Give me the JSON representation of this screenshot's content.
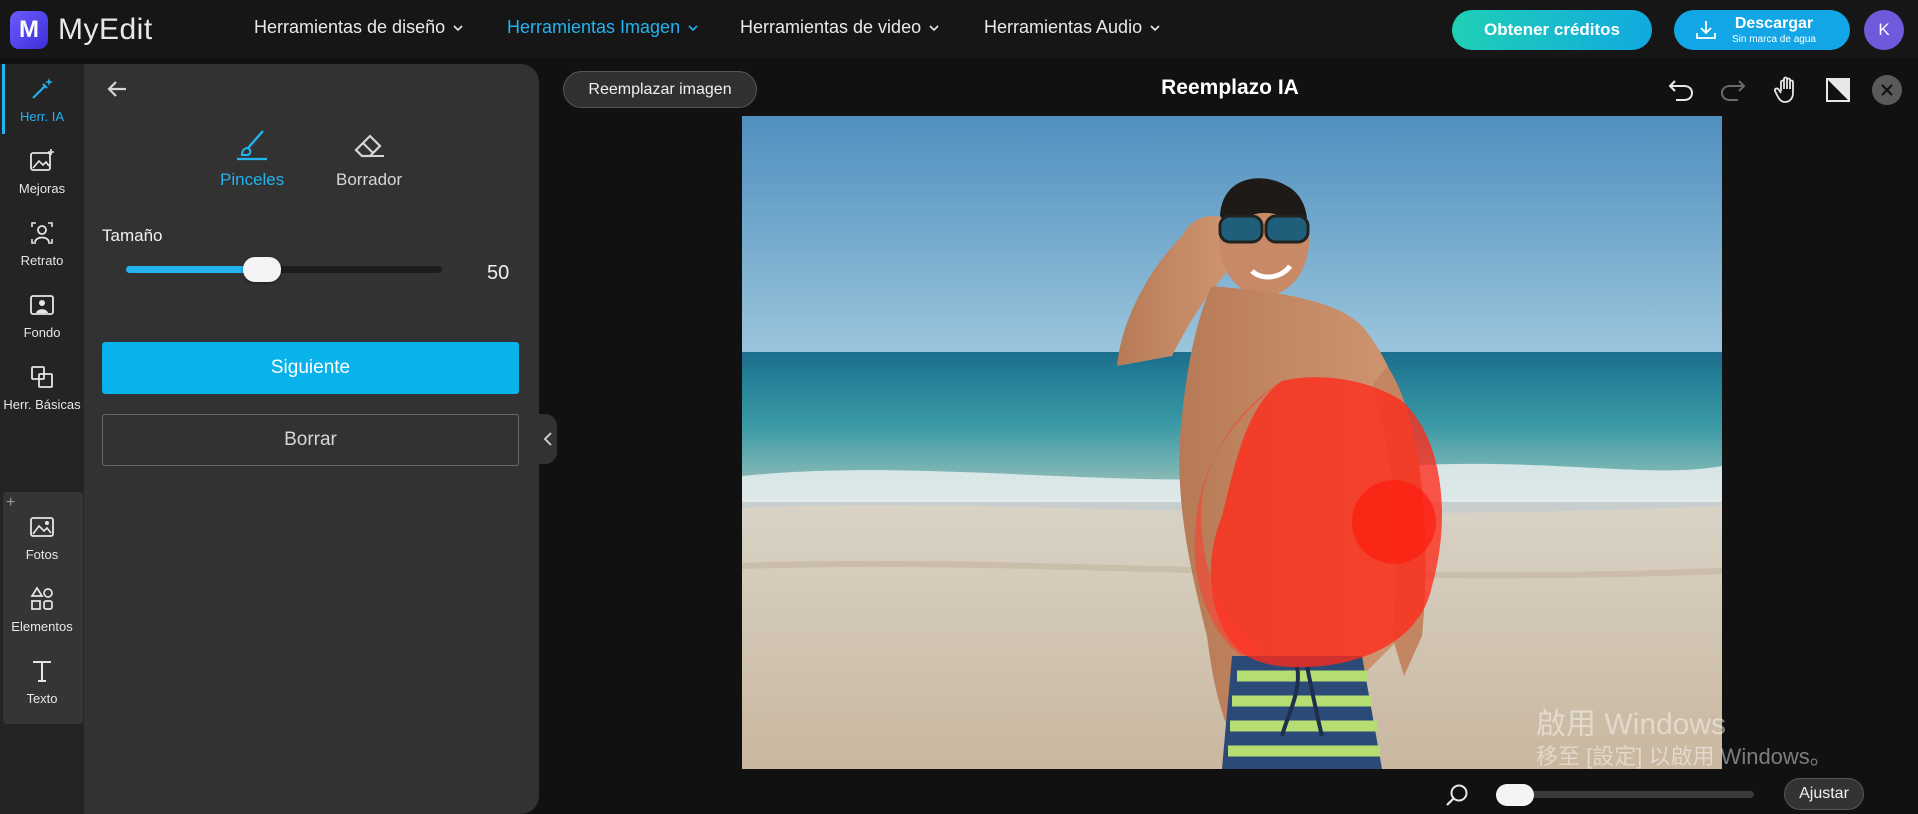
{
  "app": {
    "logo_letter": "M",
    "name": "MyEdit"
  },
  "nav": [
    {
      "label": "Herramientas de diseño",
      "active": false
    },
    {
      "label": "Herramientas Imagen",
      "active": true
    },
    {
      "label": "Herramientas de video",
      "active": false
    },
    {
      "label": "Herramientas Audio",
      "active": false
    }
  ],
  "header": {
    "credits_label": "Obtener créditos",
    "download_label": "Descargar",
    "download_sub": "Sin marca de agua",
    "avatar_letter": "K"
  },
  "rail": {
    "items": [
      {
        "label": "Herr. IA",
        "icon": "magic-wand-icon"
      },
      {
        "label": "Mejoras",
        "icon": "image-enhance-icon"
      },
      {
        "label": "Retrato",
        "icon": "portrait-icon"
      },
      {
        "label": "Fondo",
        "icon": "background-icon"
      },
      {
        "label": "Herr. Básicas",
        "icon": "basic-tools-icon"
      },
      {
        "label": "Fotos",
        "icon": "photos-icon"
      },
      {
        "label": "Elementos",
        "icon": "elements-icon"
      },
      {
        "label": "Texto",
        "icon": "text-icon"
      }
    ],
    "plus": "+"
  },
  "panel": {
    "tabs": [
      {
        "label": "Pinceles",
        "icon": "brush-icon",
        "active": true
      },
      {
        "label": "Borrador",
        "icon": "eraser-icon",
        "active": false
      }
    ],
    "size_label": "Tamaño",
    "size_value": "50",
    "size_fraction": 0.43,
    "next_label": "Siguiente",
    "clear_label": "Borrar"
  },
  "canvas": {
    "replace_label": "Reemplazar imagen",
    "title": "Reemplazo IA",
    "zoom_fraction": 0.06,
    "fit_label": "Ajustar"
  },
  "watermark": {
    "line1": "啟用 Windows",
    "line2": "移至 [設定] 以啟用 Windows。"
  },
  "colors": {
    "accent": "#22b3f0",
    "mask": "#ff2a1a"
  }
}
